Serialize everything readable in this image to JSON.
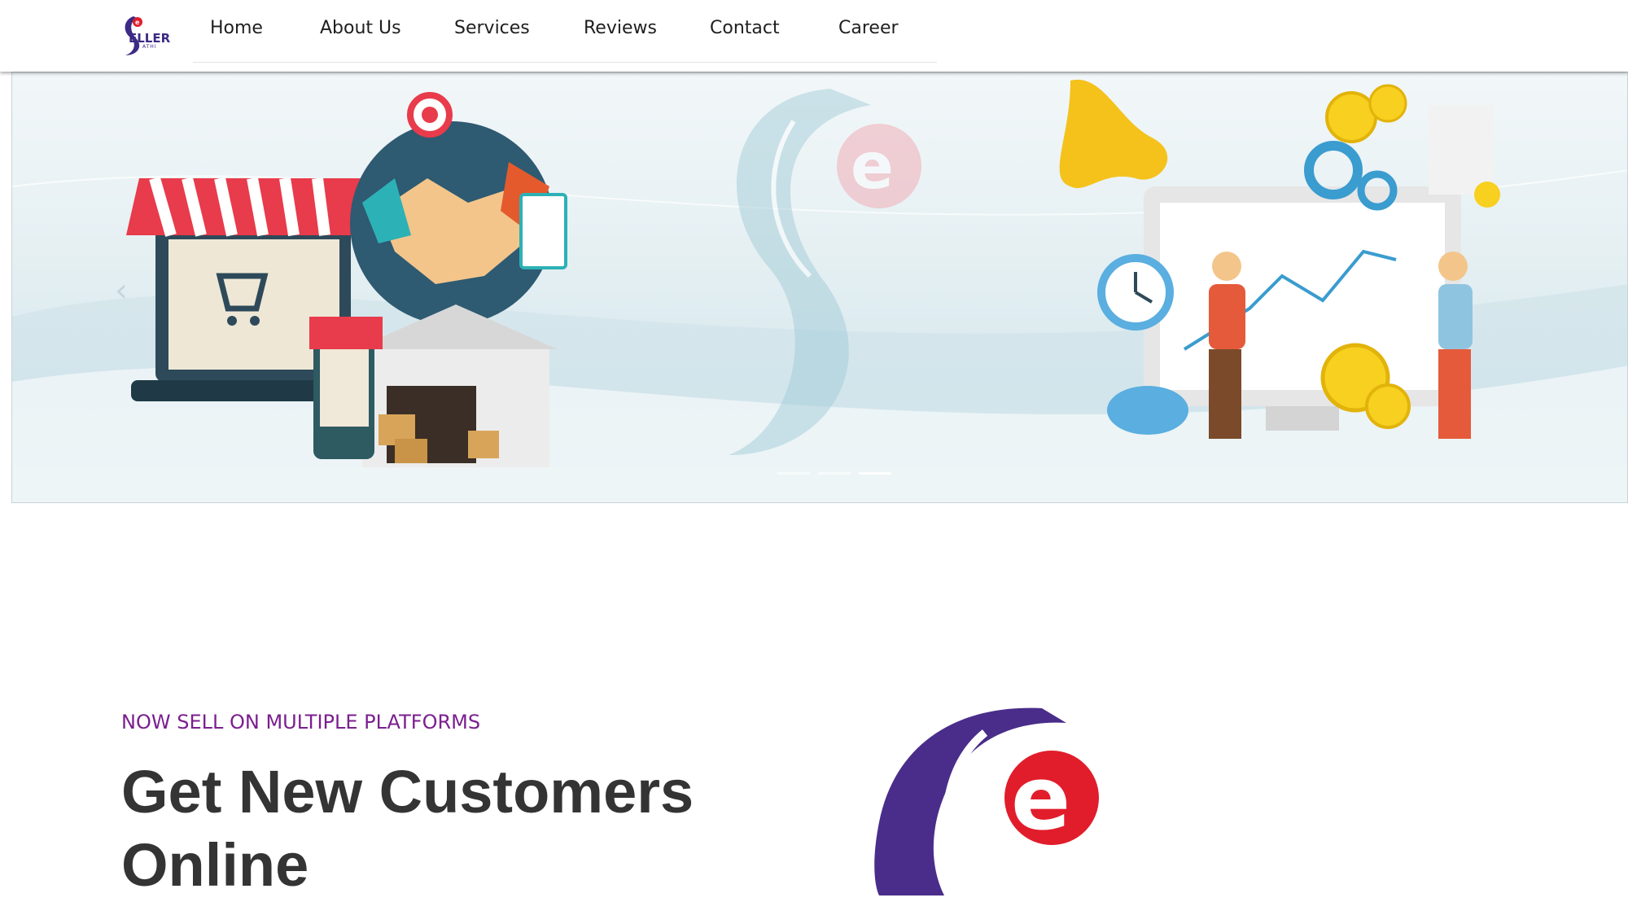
{
  "brand": {
    "logo_text": "ELLER",
    "logo_sub": "ATHI"
  },
  "nav": {
    "items": [
      {
        "label": "Home"
      },
      {
        "label": "About Us"
      },
      {
        "label": "Services"
      },
      {
        "label": "Reviews"
      },
      {
        "label": "Contact"
      },
      {
        "label": "Career"
      }
    ]
  },
  "banner": {
    "prev_icon": "chevron-left-icon",
    "slides": 3,
    "active_slide": 3
  },
  "hero": {
    "eyebrow": "NOW SELL ON MULTIPLE PLATFORMS",
    "headline": "Get New Customers Online"
  },
  "colors": {
    "brand_purple": "#4a2d8a",
    "brand_red": "#e11d2b",
    "eyebrow": "#7b1f8f",
    "headline": "#343434"
  }
}
